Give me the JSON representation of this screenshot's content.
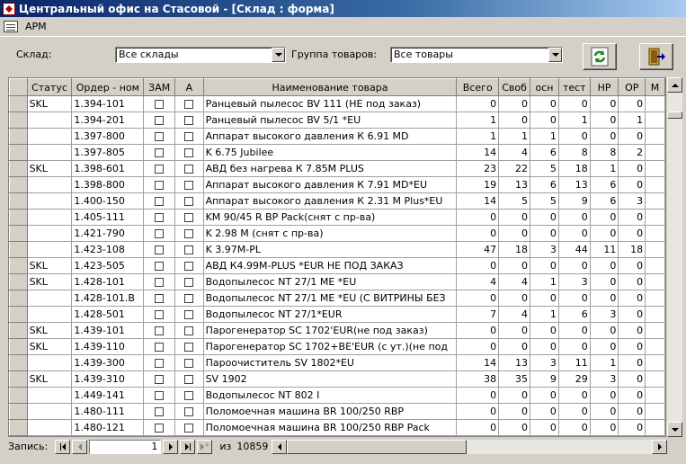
{
  "window": {
    "title": "Центральный офис на  Стасовой - [Склад : форма]"
  },
  "menu": {
    "items": [
      {
        "label": "АРМ"
      }
    ]
  },
  "filters": {
    "warehouse_label": "Склад:",
    "warehouse_value": "Все склады",
    "group_label": "Группа товаров:",
    "group_value": "Все товары"
  },
  "toolbar": {
    "refresh_icon": "refresh-icon",
    "exit_icon": "exit-door-icon"
  },
  "grid": {
    "columns": [
      "Статус",
      "Ордер - ном",
      "ЗАМ",
      "А",
      "Наименование товара",
      "Всего",
      "Своб",
      "осн",
      "тест",
      "НР",
      "ОР",
      "М"
    ],
    "rows": [
      {
        "status": "SKL",
        "order": "1.394-101",
        "name": "Ранцевый пылесос  BV 111 (НЕ под заказ)",
        "v": [
          "0",
          "0",
          "0",
          "0",
          "0",
          "0"
        ]
      },
      {
        "status": "",
        "order": "1.394-201",
        "name": "Ранцевый пылесос BV 5/1  *EU",
        "v": [
          "1",
          "0",
          "0",
          "1",
          "0",
          "1"
        ]
      },
      {
        "status": "",
        "order": "1.397-800",
        "name": "Аппарат высокого давления К 6.91 MD",
        "v": [
          "1",
          "1",
          "1",
          "0",
          "0",
          "0"
        ]
      },
      {
        "status": "",
        "order": "1.397-805",
        "name": "K 6.75 Jubilee",
        "v": [
          "14",
          "4",
          "6",
          "8",
          "8",
          "2"
        ]
      },
      {
        "status": "SKL",
        "order": "1.398-601",
        "name": "АВД без нагрева К 7.85M PLUS",
        "v": [
          "23",
          "22",
          "5",
          "18",
          "1",
          "0"
        ]
      },
      {
        "status": "",
        "order": "1.398-800",
        "name": "Аппарат высокого давления К 7.91 MD*EU",
        "v": [
          "19",
          "13",
          "6",
          "13",
          "6",
          "0"
        ]
      },
      {
        "status": "",
        "order": "1.400-150",
        "name": "Аппарат высокого давления К 2.31 M Plus*EU",
        "v": [
          "14",
          "5",
          "5",
          "9",
          "6",
          "3"
        ]
      },
      {
        "status": "",
        "order": "1.405-111",
        "name": "KM 90/45 R BP Pack(снят с пр-ва)",
        "v": [
          "0",
          "0",
          "0",
          "0",
          "0",
          "0"
        ]
      },
      {
        "status": "",
        "order": "1.421-790",
        "name": "K 2.98 M (снят с пр-ва)",
        "v": [
          "0",
          "0",
          "0",
          "0",
          "0",
          "0"
        ]
      },
      {
        "status": "",
        "order": "1.423-108",
        "name": "K 3.97M-PL",
        "v": [
          "47",
          "18",
          "3",
          "44",
          "11",
          "18"
        ]
      },
      {
        "status": "SKL",
        "order": "1.423-505",
        "name": "АВД К4.99M-PLUS *EUR НЕ ПОД ЗАКАЗ",
        "v": [
          "0",
          "0",
          "0",
          "0",
          "0",
          "0"
        ]
      },
      {
        "status": "SKL",
        "order": "1.428-101",
        "name": "Водопылесос NT 27/1 ME *EU",
        "v": [
          "4",
          "4",
          "1",
          "3",
          "0",
          "0"
        ]
      },
      {
        "status": "",
        "order": "1.428-101.В",
        "name": "Водопылесос NT 27/1 ME *EU (С ВИТРИНЫ БЕЗ",
        "v": [
          "0",
          "0",
          "0",
          "0",
          "0",
          "0"
        ]
      },
      {
        "status": "",
        "order": "1.428-501",
        "name": "Водопылесос NT 27/1*EUR",
        "v": [
          "7",
          "4",
          "1",
          "6",
          "3",
          "0"
        ]
      },
      {
        "status": "SKL",
        "order": "1.439-101",
        "name": "Парогенератор SC 1702'EUR(не под заказ)",
        "v": [
          "0",
          "0",
          "0",
          "0",
          "0",
          "0"
        ]
      },
      {
        "status": "SKL",
        "order": "1.439-110",
        "name": "Парогенератор SC 1702+BE'EUR (с ут.)(не под",
        "v": [
          "0",
          "0",
          "0",
          "0",
          "0",
          "0"
        ]
      },
      {
        "status": "",
        "order": "1.439-300",
        "name": "Пароочиститель SV 1802*EU",
        "v": [
          "14",
          "13",
          "3",
          "11",
          "1",
          "0"
        ]
      },
      {
        "status": "SKL",
        "order": "1.439-310",
        "name": "SV 1902",
        "v": [
          "38",
          "35",
          "9",
          "29",
          "3",
          "0"
        ]
      },
      {
        "status": "",
        "order": "1.449-141",
        "name": "Водопылесос NT 802 I",
        "v": [
          "0",
          "0",
          "0",
          "0",
          "0",
          "0"
        ]
      },
      {
        "status": "",
        "order": "1.480-111",
        "name": "Поломоечная машина BR 100/250 RBP",
        "v": [
          "0",
          "0",
          "0",
          "0",
          "0",
          "0"
        ]
      },
      {
        "status": "",
        "order": "1.480-121",
        "name": "Поломоечная машина BR 100/250 RBP Pack",
        "v": [
          "0",
          "0",
          "0",
          "0",
          "0",
          "0"
        ]
      }
    ]
  },
  "nav": {
    "record_label": "Запись:",
    "current": "1",
    "of_label": "из",
    "total": "10859"
  }
}
